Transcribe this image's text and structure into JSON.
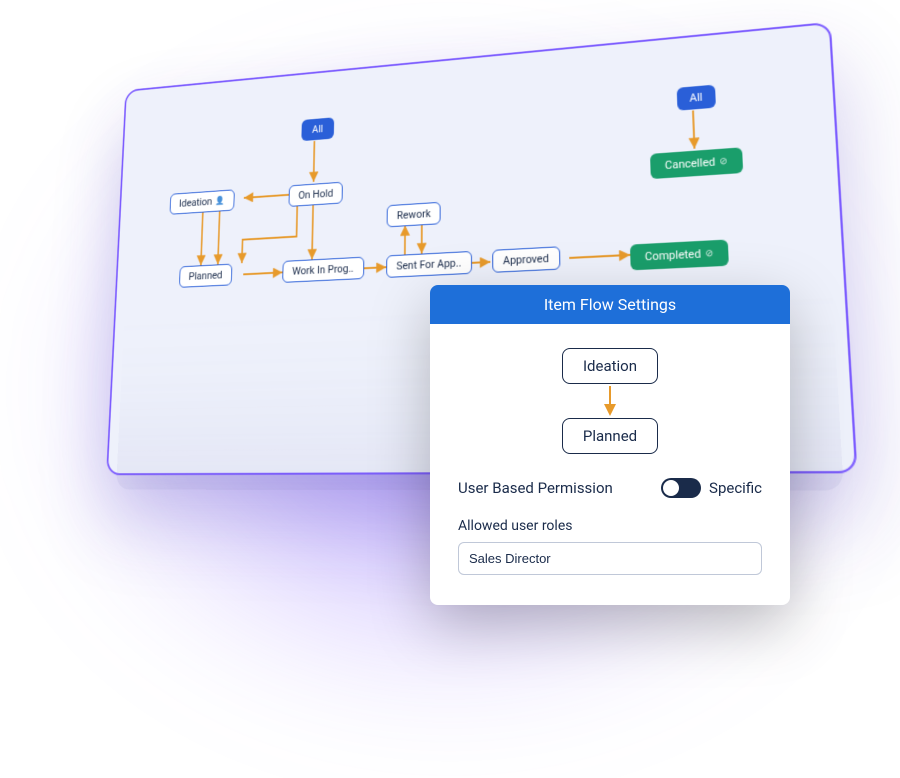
{
  "workflow": {
    "nodes": {
      "all1": "All",
      "all2": "All",
      "ideation": "Ideation",
      "onhold": "On Hold",
      "rework": "Rework",
      "planned": "Planned",
      "wip": "Work In Prog..",
      "sentapp": "Sent For App..",
      "approved": "Approved",
      "cancelled": "Cancelled",
      "completed": "Completed"
    }
  },
  "modal": {
    "title": "Item Flow Settings",
    "from": "Ideation",
    "to": "Planned",
    "permission_label": "User Based Permission",
    "toggle_label": "Specific",
    "roles_label": "Allowed user roles",
    "roles_value": "Sales Director"
  }
}
